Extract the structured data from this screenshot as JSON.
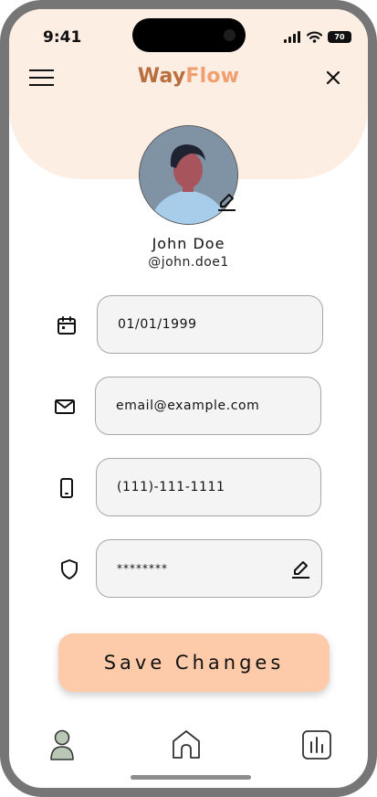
{
  "status_bar": {
    "time": "9:41",
    "battery": "70"
  },
  "header": {
    "logo_part1": "Way",
    "logo_part2": "Flow",
    "logo_color1": "#b86e3e",
    "logo_color2": "#f0a070",
    "menu_icon": "hamburger-menu-icon",
    "close_icon": "close-icon"
  },
  "profile": {
    "name": "John Doe",
    "handle": "@john.doe1",
    "edit_icon": "pencil-icon"
  },
  "fields": [
    {
      "icon": "calendar-icon",
      "value": "01/01/1999"
    },
    {
      "icon": "mail-icon",
      "value": "email@example.com"
    },
    {
      "icon": "phone-icon",
      "value": "(111)-111-1111"
    },
    {
      "icon": "shield-icon",
      "value": "********",
      "edit_icon": "pencil-icon"
    }
  ],
  "save_button": {
    "label": "Save Changes",
    "color": "#fdcbaa"
  },
  "bottom_nav": [
    {
      "icon": "profile-icon",
      "active": true,
      "active_color": "#b8c8b4"
    },
    {
      "icon": "home-icon",
      "active": false
    },
    {
      "icon": "analytics-icon",
      "active": false
    }
  ]
}
